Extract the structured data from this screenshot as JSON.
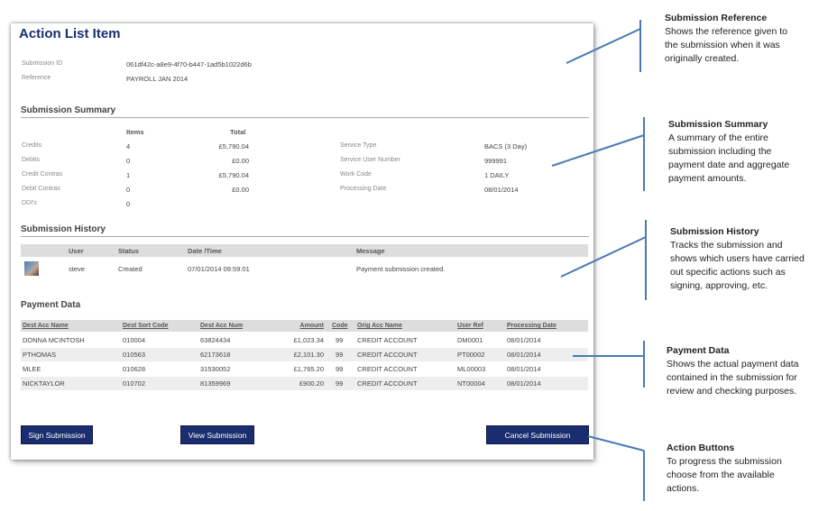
{
  "page": {
    "title": "Action List Item"
  },
  "reference": {
    "submission_id_label": "Submission ID",
    "submission_id": "061df42c-a8e9-4f70-b447-1ad5b1022d6b",
    "reference_label": "Reference",
    "reference": "PAYROLL JAN 2014"
  },
  "summary": {
    "title": "Submission Summary",
    "items_header": "Items",
    "total_header": "Total",
    "rows": [
      {
        "label": "Credits",
        "items": "4",
        "total": "£5,790.04"
      },
      {
        "label": "Debits",
        "items": "0",
        "total": "£0.00"
      },
      {
        "label": "Credit Contras",
        "items": "1",
        "total": "£5,790.04"
      },
      {
        "label": "Debit Contras",
        "items": "0",
        "total": "£0.00"
      },
      {
        "label": "DDI's",
        "items": "0",
        "total": ""
      }
    ],
    "details": [
      {
        "label": "Service Type",
        "value": "BACS (3 Day)"
      },
      {
        "label": "Service User Number",
        "value": "999991"
      },
      {
        "label": "Work Code",
        "value": "1 DAILY"
      },
      {
        "label": "Processing Date",
        "value": "08/01/2014"
      }
    ]
  },
  "history": {
    "title": "Submission History",
    "headers": {
      "user": "User",
      "status": "Status",
      "datetime": "Date /Time",
      "message": "Message"
    },
    "rows": [
      {
        "user": "steve",
        "status": "Created",
        "datetime": "07/01/2014 09:59:01",
        "message": "Payment submission created."
      }
    ]
  },
  "payment": {
    "title": "Payment Data",
    "headers": {
      "dest_acc_name": "Dest Acc Name",
      "dest_sort_code": "Dest Sort Code",
      "dest_acc_num": "Dest Acc Num",
      "amount": "Amount",
      "code": "Code",
      "orig_acc_name": "Orig Acc Name",
      "user_ref": "User Ref",
      "processing_date": "Processing Date"
    },
    "rows": [
      {
        "name": "DONNA MCINTOSH",
        "sort": "010004",
        "num": "63824434",
        "amount": "£1,023.34",
        "code": "99",
        "orig": "CREDIT ACCOUNT",
        "ref": "DM0001",
        "date": "08/01/2014"
      },
      {
        "name": "PTHOMAS",
        "sort": "010563",
        "num": "62173618",
        "amount": "£2,101.30",
        "code": "99",
        "orig": "CREDIT ACCOUNT",
        "ref": "PT00002",
        "date": "08/01/2014"
      },
      {
        "name": "MLEE",
        "sort": "010628",
        "num": "31530052",
        "amount": "£1,765.20",
        "code": "99",
        "orig": "CREDIT ACCOUNT",
        "ref": "ML00003",
        "date": "08/01/2014"
      },
      {
        "name": "NICKTAYLOR",
        "sort": "010702",
        "num": "81359969",
        "amount": "£900.20",
        "code": "99",
        "orig": "CREDIT ACCOUNT",
        "ref": "NT00004",
        "date": "08/01/2014"
      }
    ]
  },
  "buttons": {
    "sign": "Sign Submission",
    "view": "View Submission",
    "cancel": "Cancel Submission"
  },
  "annotations": [
    {
      "heading": "Submission Reference",
      "lines": [
        "Shows the reference given to",
        "the submission when it was",
        "originally created."
      ]
    },
    {
      "heading": "Submission Summary",
      "lines": [
        "A summary of the entire",
        "submission including the",
        "payment date and aggregate",
        "payment amounts."
      ]
    },
    {
      "heading": "Submission History",
      "lines": [
        "Tracks the submission and",
        "shows which users have carried",
        "out specific actions such as",
        "signing, approving, etc."
      ]
    },
    {
      "heading": "Payment Data",
      "lines": [
        "Shows the actual payment data",
        "contained in the submission for",
        "review and checking purposes."
      ]
    },
    {
      "heading": "Action Buttons",
      "lines": [
        "To progress the submission",
        "choose from the available",
        "actions."
      ]
    }
  ],
  "colors": {
    "brand": "#1a2d6e",
    "callout_line": "#4a7ab5"
  }
}
